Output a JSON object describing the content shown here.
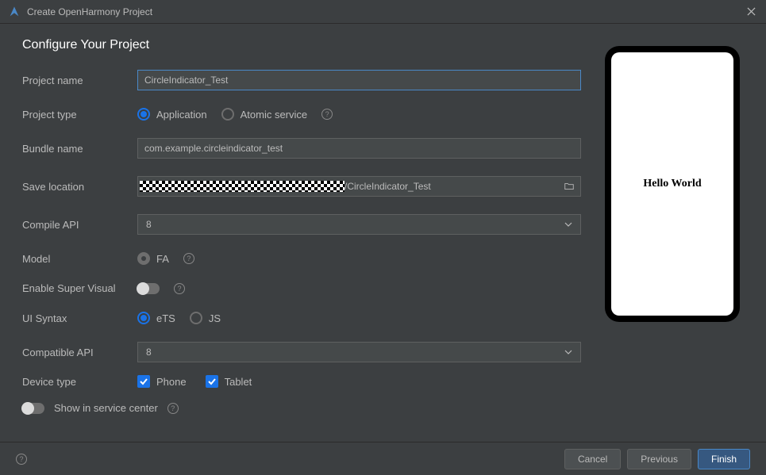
{
  "window": {
    "title": "Create OpenHarmony Project"
  },
  "heading": "Configure Your Project",
  "labels": {
    "project_name": "Project name",
    "project_type": "Project type",
    "bundle_name": "Bundle name",
    "save_location": "Save location",
    "compile_api": "Compile API",
    "model": "Model",
    "enable_super_visual": "Enable Super Visual",
    "ui_syntax": "UI Syntax",
    "compatible_api": "Compatible API",
    "device_type": "Device type",
    "show_in_service_center": "Show in service center"
  },
  "values": {
    "project_name": "CircleIndicator_Test",
    "bundle_name": "com.example.circleindicator_test",
    "save_location_suffix": "/CircleIndicator_Test",
    "compile_api": "8",
    "compatible_api": "8"
  },
  "project_type": {
    "application": "Application",
    "atomic_service": "Atomic service"
  },
  "model": {
    "fa": "FA"
  },
  "ui_syntax": {
    "ets": "eTS",
    "js": "JS"
  },
  "device_type": {
    "phone": "Phone",
    "tablet": "Tablet"
  },
  "preview": {
    "text": "Hello World"
  },
  "footer": {
    "cancel": "Cancel",
    "previous": "Previous",
    "finish": "Finish"
  }
}
